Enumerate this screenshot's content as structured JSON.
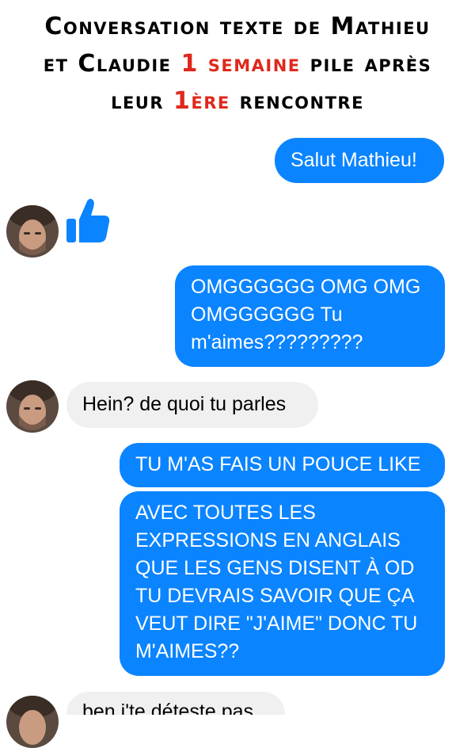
{
  "header": {
    "line1": "Conversation texte de Mathieu",
    "line2_pre": "et Claudie ",
    "line2_red": "1 semaine",
    "line2_post": " pile après",
    "line3_pre": "leur ",
    "line3_red": "1ère",
    "line3_post": " rencontre",
    "accent_color": "#e0281c"
  },
  "messages": [
    {
      "from": "claudie",
      "text": "Salut Mathieu!"
    },
    {
      "from": "mathieu",
      "icon": "thumbs-up-icon"
    },
    {
      "from": "claudie",
      "text": "OMGGGGGG OMG OMG\nOMGGGGGG Tu\nm'aimes?????????"
    },
    {
      "from": "mathieu",
      "text": "Hein? de quoi tu parles"
    },
    {
      "from": "claudie",
      "text": "TU M'AS FAIS UN POUCE LIKE"
    },
    {
      "from": "claudie",
      "text": "AVEC TOUTES LES\nEXPRESSIONS EN ANGLAIS\nQUE LES GENS DISENT À OD\nTU DEVRAIS SAVOIR QUE ÇA\nVEUT DIRE \"J'AIME\" DONC TU\nM'AIMES??"
    },
    {
      "from": "mathieu",
      "text": "ben j'te déteste pas"
    }
  ],
  "colors": {
    "outgoing_bubble": "#0b84ff",
    "incoming_bubble": "#f0f0f0"
  }
}
